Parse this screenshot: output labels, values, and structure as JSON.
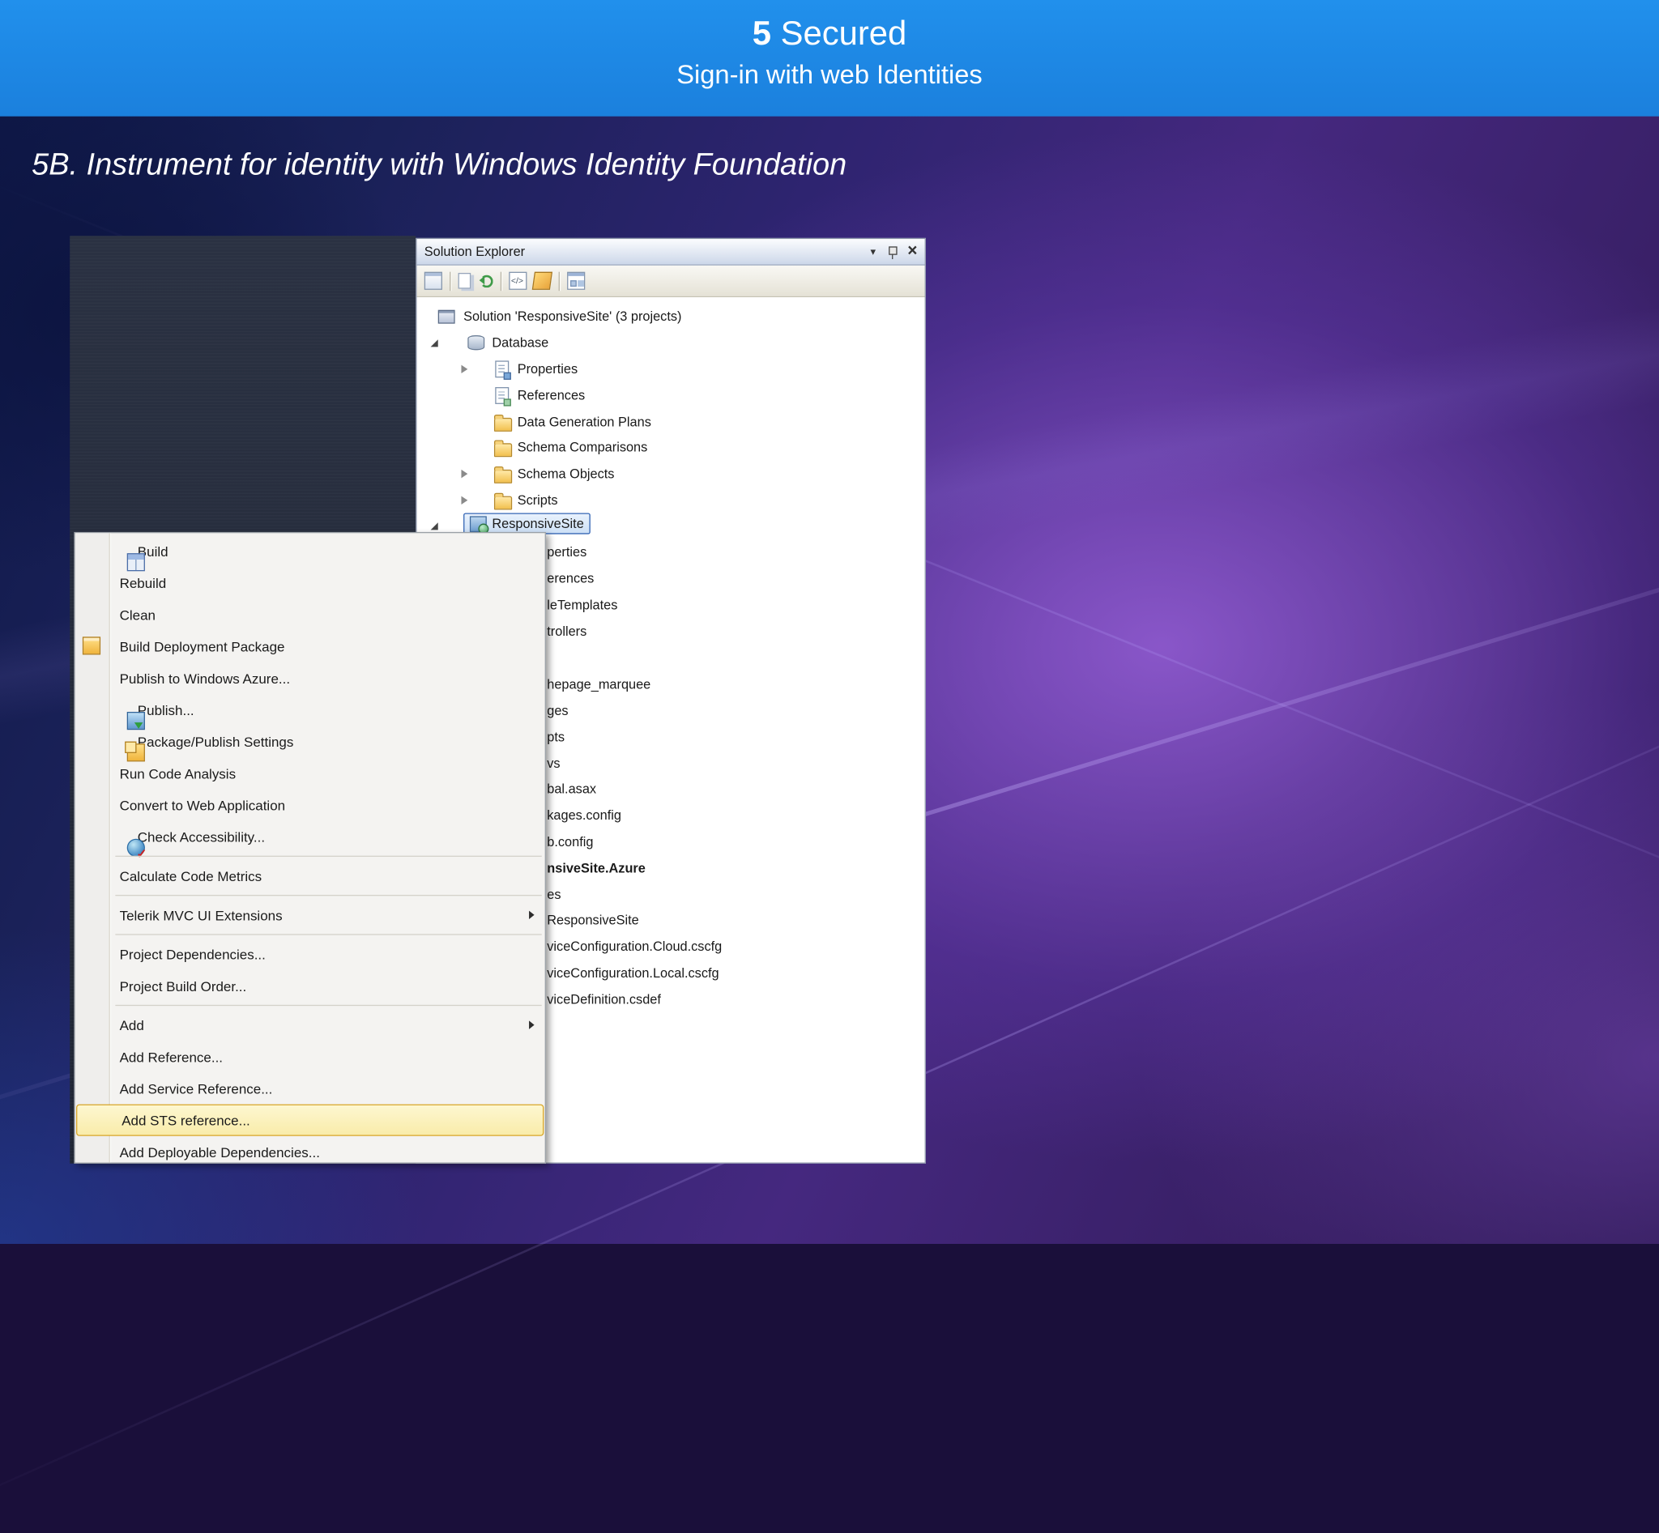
{
  "slide": {
    "header": {
      "number": "5",
      "title": " Secured",
      "subtitle": "Sign-in with web Identities"
    },
    "heading": "5B. Instrument for identity with Windows Identity Foundation"
  },
  "solution_explorer": {
    "title": "Solution Explorer",
    "tree": [
      {
        "label": "Solution 'ResponsiveSite' (3 projects)",
        "icon": "solution-icon"
      },
      {
        "label": "Database",
        "icon": "database-project-icon",
        "state": "expanded"
      },
      {
        "label": "Properties",
        "icon": "properties-node-icon",
        "state": "collapsed"
      },
      {
        "label": "References",
        "icon": "references-icon"
      },
      {
        "label": "Data Generation Plans",
        "icon": "folder-icon"
      },
      {
        "label": "Schema Comparisons",
        "icon": "folder-icon"
      },
      {
        "label": "Schema Objects",
        "icon": "folder-icon",
        "state": "collapsed"
      },
      {
        "label": "Scripts",
        "icon": "folder-icon",
        "state": "collapsed"
      },
      {
        "label": "ResponsiveSite",
        "icon": "web-project-icon",
        "selected": true,
        "state": "expanded"
      }
    ],
    "partially_hidden_items": [
      "perties",
      "erences",
      "leTemplates",
      "trollers",
      "hepage_marquee",
      "ges",
      "pts",
      "vs",
      "bal.asax",
      "kages.config",
      "b.config",
      "nsiveSite.Azure",
      "es",
      "ResponsiveSite",
      "viceConfiguration.Cloud.cscfg",
      "viceConfiguration.Local.cscfg",
      "viceDefinition.csdef"
    ]
  },
  "context_menu": {
    "items": [
      {
        "label": "Build",
        "icon": "build-icon"
      },
      {
        "label": "Rebuild"
      },
      {
        "label": "Clean"
      },
      {
        "label": "Build Deployment Package",
        "icon": "deployment-package-icon"
      },
      {
        "label": "Publish to Windows Azure..."
      },
      {
        "label": "Publish...",
        "icon": "publish-icon"
      },
      {
        "label": "Package/Publish Settings",
        "icon": "package-settings-icon"
      },
      {
        "label": "Run Code Analysis"
      },
      {
        "label": "Convert to Web Application"
      },
      {
        "label": "Check Accessibility...",
        "icon": "accessibility-icon"
      },
      {
        "type": "separator"
      },
      {
        "label": "Calculate Code Metrics"
      },
      {
        "type": "separator"
      },
      {
        "label": "Telerik MVC UI Extensions",
        "submenu": true
      },
      {
        "type": "separator"
      },
      {
        "label": "Project Dependencies..."
      },
      {
        "label": "Project Build Order..."
      },
      {
        "type": "separator"
      },
      {
        "label": "Add",
        "submenu": true
      },
      {
        "label": "Add Reference..."
      },
      {
        "label": "Add Service Reference..."
      },
      {
        "label": "Add STS reference...",
        "highlighted": true
      },
      {
        "label": "Add Deployable Dependencies..."
      }
    ]
  },
  "colors": {
    "header_blue": "#1d87e6",
    "menu_highlight": "#fbf3c0",
    "menu_highlight_border": "#d8a525",
    "selection_border": "#3264b4"
  }
}
